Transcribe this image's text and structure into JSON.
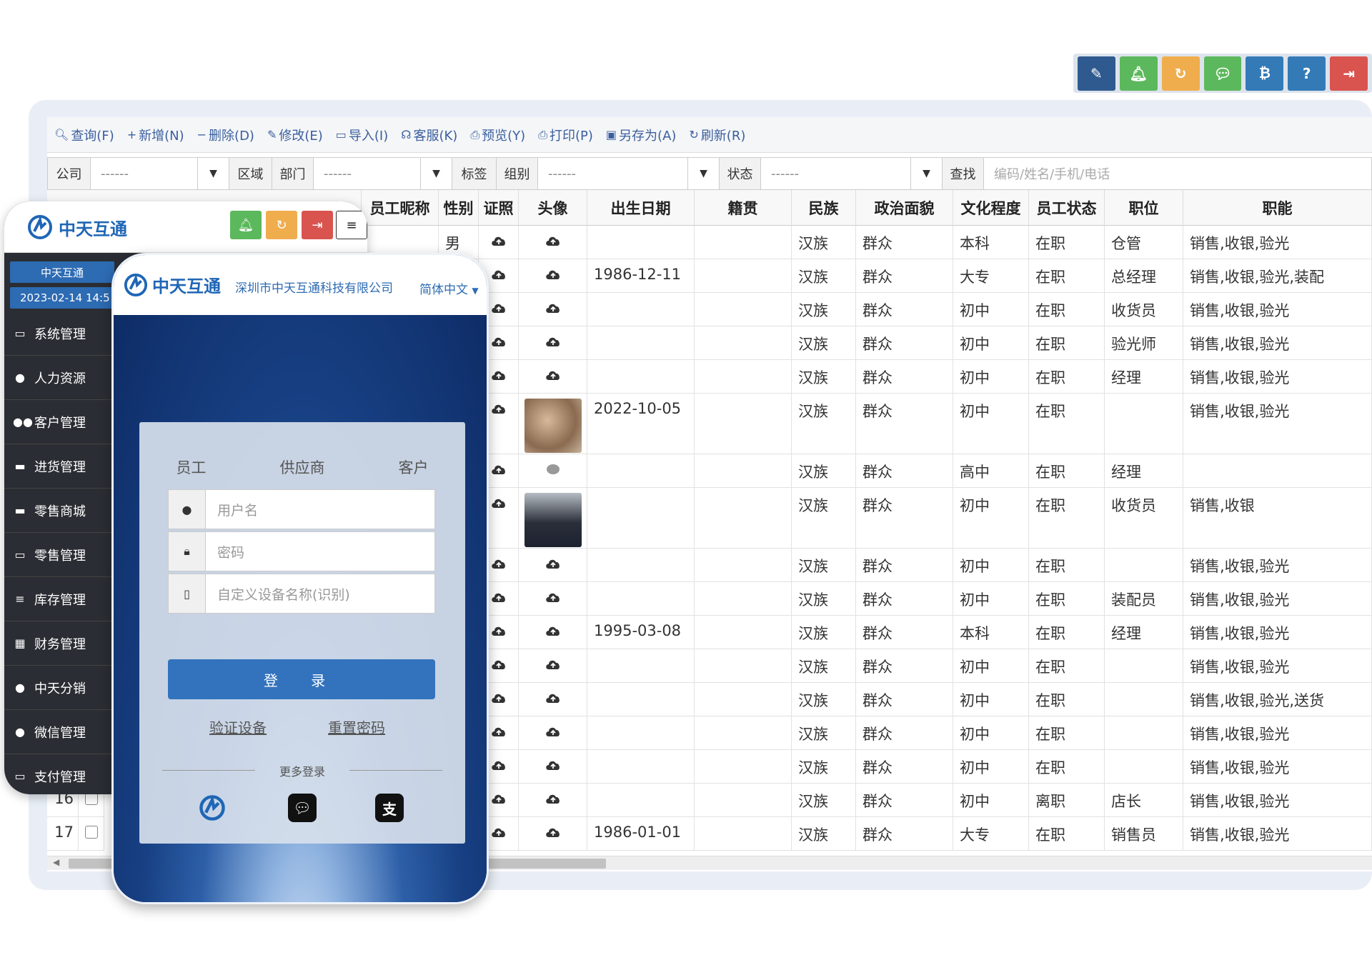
{
  "topbar": {
    "buttons": [
      {
        "name": "edit-icon",
        "glyph": "✎",
        "color": "#2f5a8f"
      },
      {
        "name": "bell-icon",
        "glyph": "🔔︎",
        "color": "#5cb85c"
      },
      {
        "name": "refresh-icon",
        "glyph": "↻",
        "color": "#f0ad4e"
      },
      {
        "name": "wechat-icon",
        "glyph": "💬︎",
        "color": "#5cb85c"
      },
      {
        "name": "bitcoin-icon",
        "glyph": "₿",
        "color": "#337ab7"
      },
      {
        "name": "help-icon",
        "glyph": "?",
        "color": "#337ab7"
      },
      {
        "name": "logout-icon",
        "glyph": "⇥",
        "color": "#d9534f"
      }
    ]
  },
  "toolbar": {
    "items": [
      {
        "glyph": "🔍︎",
        "label": "查询(F)"
      },
      {
        "glyph": "+",
        "label": "新增(N)"
      },
      {
        "glyph": "−",
        "label": "删除(D)"
      },
      {
        "glyph": "✎",
        "label": "修改(E)"
      },
      {
        "glyph": "▭",
        "label": "导入(I)"
      },
      {
        "glyph": "☊",
        "label": "客服(K)"
      },
      {
        "glyph": "⎙",
        "label": "预览(Y)"
      },
      {
        "glyph": "⎙",
        "label": "打印(P)"
      },
      {
        "glyph": "▣",
        "label": "另存为(A)"
      },
      {
        "glyph": "↻",
        "label": "刷新(R)"
      }
    ]
  },
  "filters": {
    "company_label": "公司",
    "company_value": "------",
    "region_label": "区域",
    "dept_label": "部门",
    "dept_value": "------",
    "tag_label": "标签",
    "group_label": "组别",
    "group_value": "------",
    "status_label": "状态",
    "status_value": "------",
    "search_label": "查找",
    "search_placeholder": "编码/姓名/手机/电话"
  },
  "grid": {
    "columns": [
      "员工昵称",
      "性别",
      "证照",
      "头像",
      "出生日期",
      "籍贯",
      "民族",
      "政治面貌",
      "文化程度",
      "员工状态",
      "职位",
      "职能"
    ],
    "rows": [
      {
        "gender": "男",
        "birth": "",
        "nation": "汉族",
        "political": "群众",
        "edu": "本科",
        "status": "在职",
        "position": "仓管",
        "duty": "销售,收银,验光"
      },
      {
        "gender": "",
        "birth": "1986-12-11",
        "nation": "汉族",
        "political": "群众",
        "edu": "大专",
        "status": "在职",
        "position": "总经理",
        "duty": "销售,收银,验光,装配"
      },
      {
        "gender": "",
        "birth": "",
        "nation": "汉族",
        "political": "群众",
        "edu": "初中",
        "status": "在职",
        "position": "收货员",
        "duty": "销售,收银,验光"
      },
      {
        "gender": "",
        "birth": "",
        "nation": "汉族",
        "political": "群众",
        "edu": "初中",
        "status": "在职",
        "position": "验光师",
        "duty": "销售,收银,验光"
      },
      {
        "gender": "",
        "birth": "",
        "nation": "汉族",
        "political": "群众",
        "edu": "初中",
        "status": "在职",
        "position": "经理",
        "duty": "销售,收银,验光"
      },
      {
        "gender": "",
        "birth": "2022-10-05",
        "nation": "汉族",
        "political": "群众",
        "edu": "初中",
        "status": "在职",
        "position": "",
        "duty": "销售,收银,验光",
        "avatar": "photo1"
      },
      {
        "gender": "",
        "birth": "",
        "nation": "汉族",
        "political": "群众",
        "edu": "高中",
        "status": "在职",
        "position": "经理",
        "duty": "",
        "avatar": "small"
      },
      {
        "gender": "",
        "birth": "",
        "nation": "汉族",
        "political": "群众",
        "edu": "初中",
        "status": "在职",
        "position": "收货员",
        "duty": "销售,收银",
        "avatar": "photo2"
      },
      {
        "gender": "",
        "birth": "",
        "nation": "汉族",
        "political": "群众",
        "edu": "初中",
        "status": "在职",
        "position": "",
        "duty": "销售,收银,验光"
      },
      {
        "gender": "",
        "birth": "",
        "nation": "汉族",
        "political": "群众",
        "edu": "初中",
        "status": "在职",
        "position": "装配员",
        "duty": "销售,收银,验光"
      },
      {
        "gender": "",
        "birth": "1995-03-08",
        "nation": "汉族",
        "political": "群众",
        "edu": "本科",
        "status": "在职",
        "position": "经理",
        "duty": "销售,收银,验光"
      },
      {
        "gender": "",
        "birth": "",
        "nation": "汉族",
        "political": "群众",
        "edu": "初中",
        "status": "在职",
        "position": "",
        "duty": "销售,收银,验光"
      },
      {
        "gender": "",
        "birth": "",
        "nation": "汉族",
        "political": "群众",
        "edu": "初中",
        "status": "在职",
        "position": "",
        "duty": "销售,收银,验光,送货"
      },
      {
        "gender": "",
        "birth": "",
        "nation": "汉族",
        "political": "群众",
        "edu": "初中",
        "status": "在职",
        "position": "",
        "duty": "销售,收银,验光"
      },
      {
        "gender": "",
        "birth": "",
        "nation": "汉族",
        "political": "群众",
        "edu": "初中",
        "status": "在职",
        "position": "",
        "duty": "销售,收银,验光"
      },
      {
        "gender": "",
        "birth": "",
        "nation": "汉族",
        "political": "群众",
        "edu": "初中",
        "status": "离职",
        "position": "店长",
        "duty": "销售,收银,验光",
        "num": "16"
      },
      {
        "gender": "",
        "birth": "1986-01-01",
        "nation": "汉族",
        "political": "群众",
        "edu": "大专",
        "status": "在职",
        "position": "销售员",
        "duty": "销售,收银,验光",
        "num": "17"
      }
    ]
  },
  "admin": {
    "logo": "中天互通",
    "company": "中天互通",
    "datetime": "2023-02-14 14:5",
    "menu": [
      {
        "icon": "monitor-icon",
        "glyph": "▭",
        "label": "系统管理"
      },
      {
        "icon": "user-icon",
        "glyph": "●",
        "label": "人力资源"
      },
      {
        "icon": "users-icon",
        "glyph": "●●",
        "label": "客户管理"
      },
      {
        "icon": "truck-icon",
        "glyph": "▬",
        "label": "进货管理"
      },
      {
        "icon": "cart-icon",
        "glyph": "▬",
        "label": "零售商城"
      },
      {
        "icon": "card-icon",
        "glyph": "▭",
        "label": "零售管理"
      },
      {
        "icon": "database-icon",
        "glyph": "≡",
        "label": "库存管理"
      },
      {
        "icon": "calculator-icon",
        "glyph": "▦",
        "label": "财务管理"
      },
      {
        "icon": "user-icon",
        "glyph": "●",
        "label": "中天分销"
      },
      {
        "icon": "wechat-icon",
        "glyph": "●",
        "label": "微信管理"
      },
      {
        "icon": "card-icon",
        "glyph": "▭",
        "label": "支付管理"
      }
    ]
  },
  "login": {
    "logo": "中天互通",
    "company": "深圳市中天互通科技有限公司",
    "language": "简体中文",
    "tabs": [
      "员工",
      "供应商",
      "客户"
    ],
    "username_placeholder": "用户名",
    "password_placeholder": "密码",
    "device_placeholder": "自定义设备名称(识别)",
    "login_label": "登 录",
    "verify_link": "验证设备",
    "reset_link": "重置密码",
    "more_login": "更多登录"
  }
}
